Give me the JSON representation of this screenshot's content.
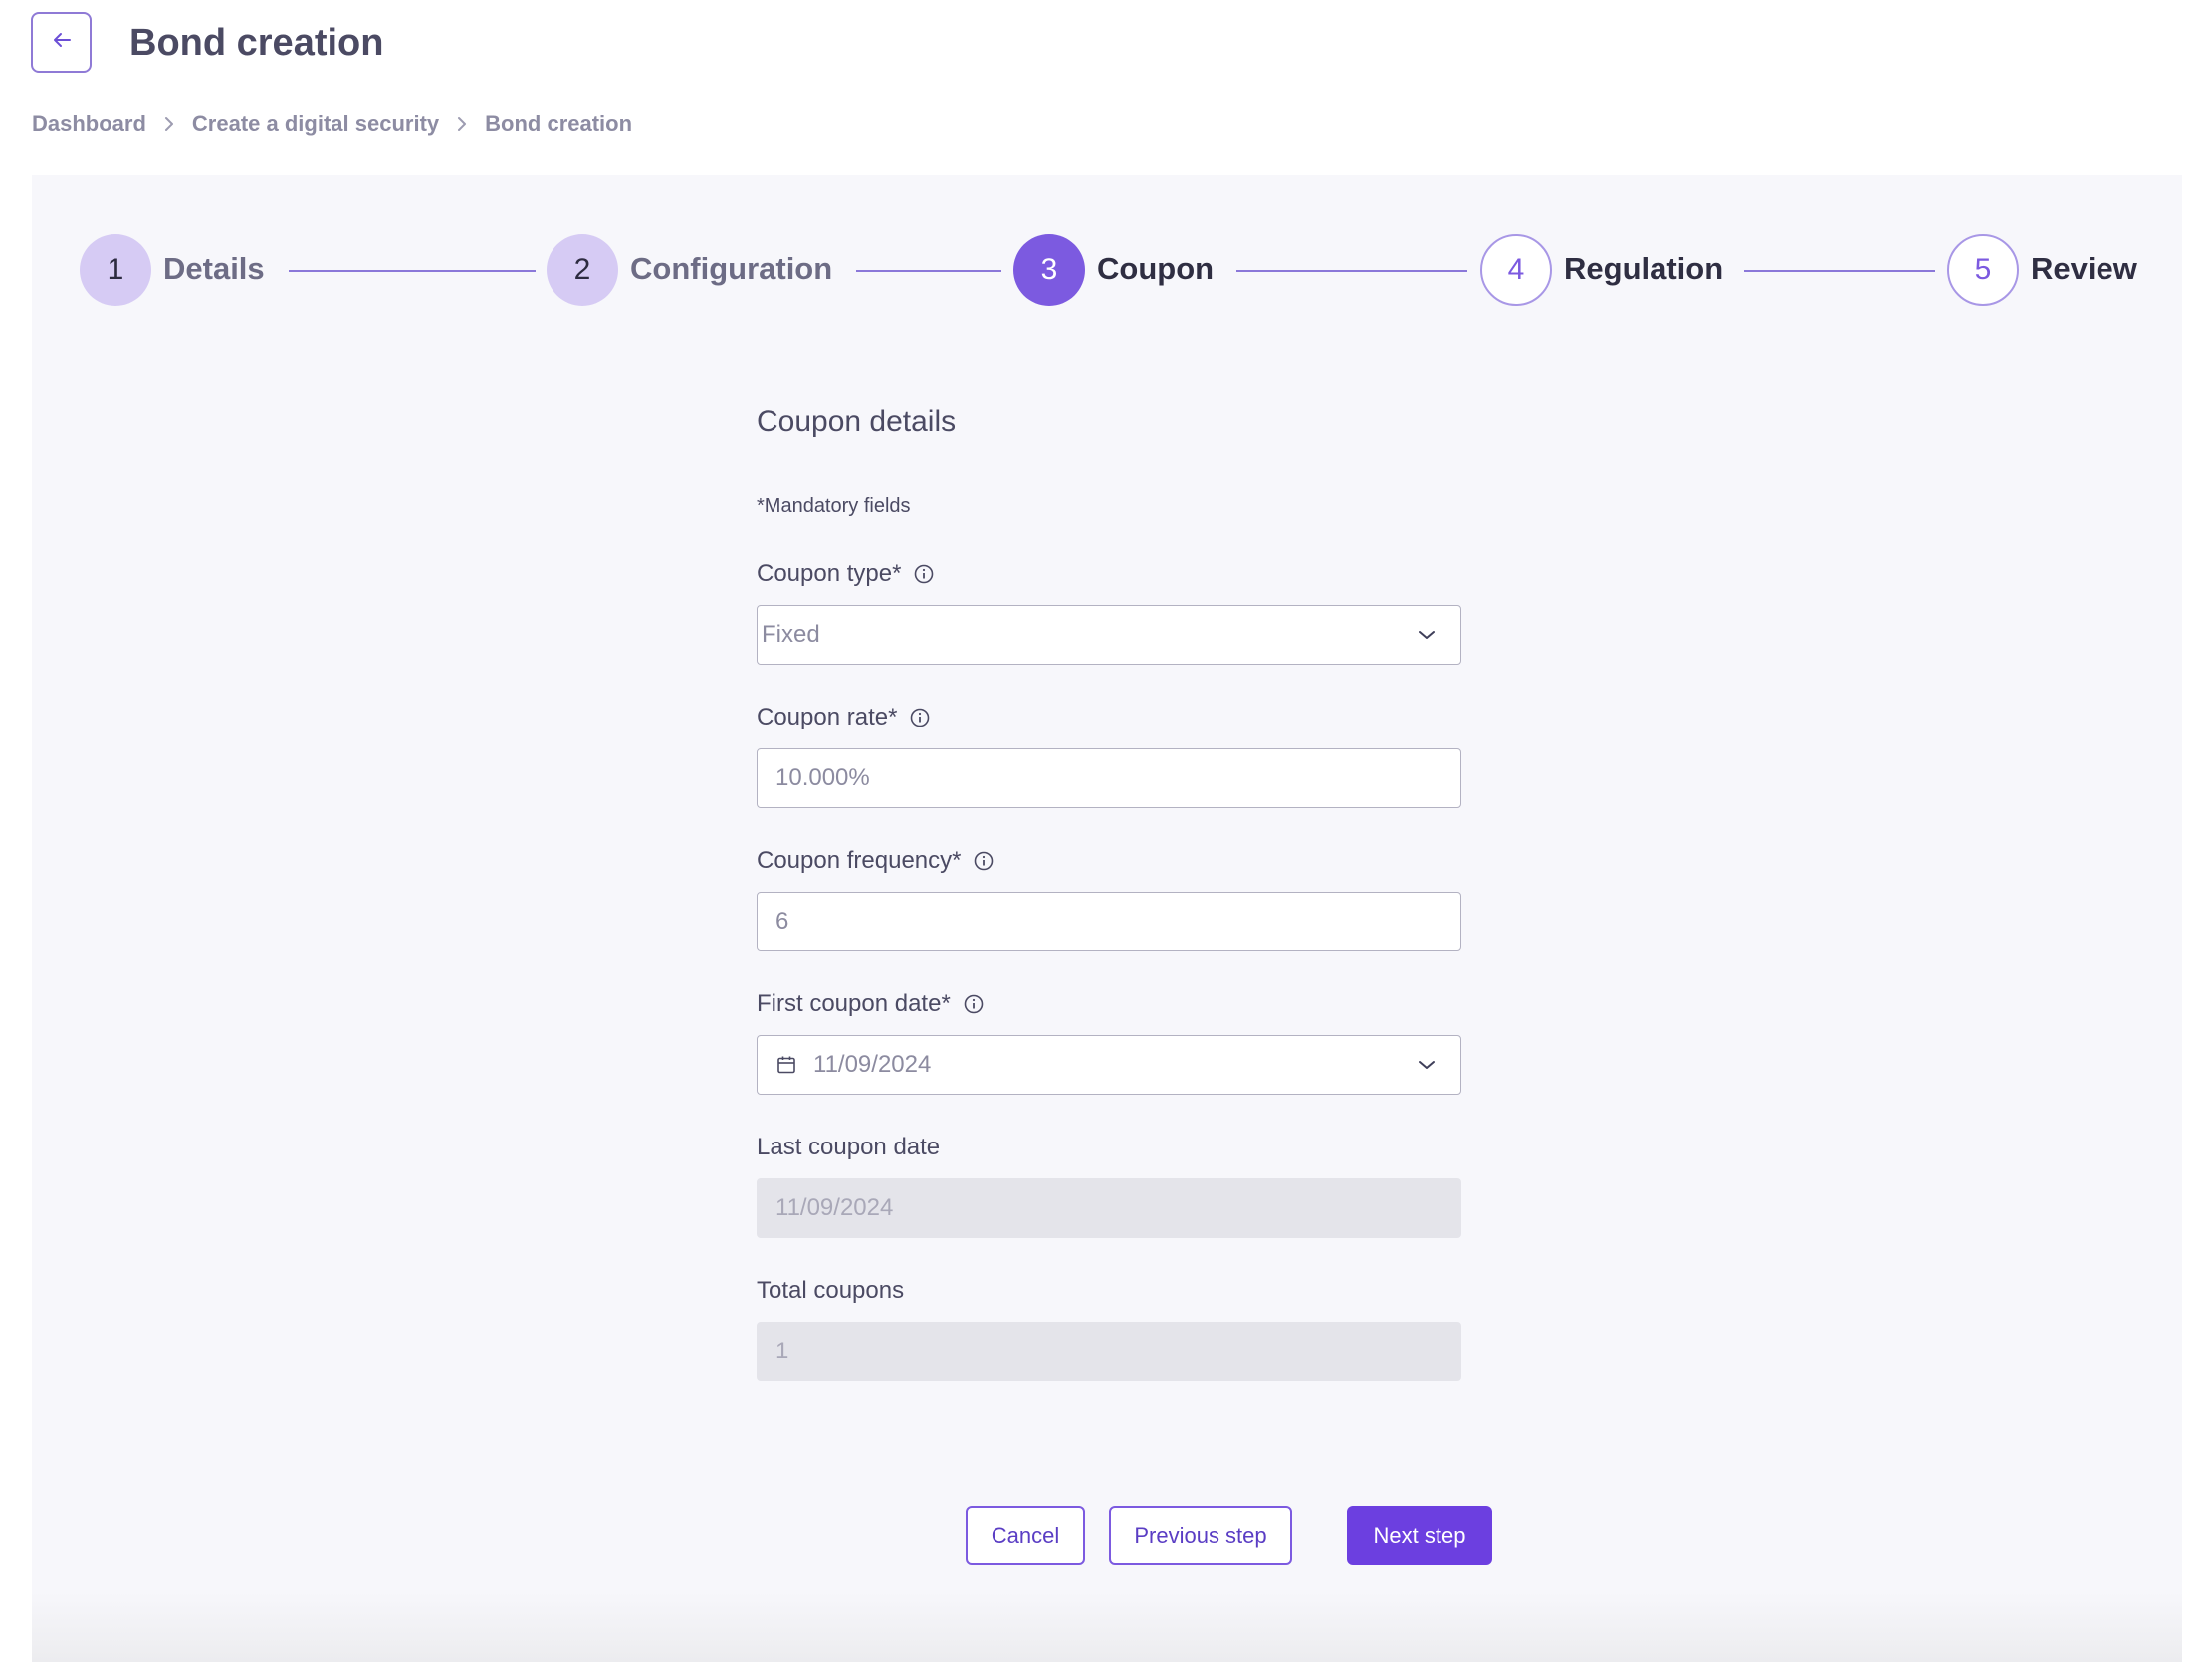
{
  "header": {
    "title": "Bond creation",
    "back_icon": "arrow-left-icon"
  },
  "breadcrumb": [
    "Dashboard",
    "Create a digital security",
    "Bond creation"
  ],
  "stepper": {
    "steps": [
      {
        "number": "1",
        "label": "Details",
        "state": "done"
      },
      {
        "number": "2",
        "label": "Configuration",
        "state": "done"
      },
      {
        "number": "3",
        "label": "Coupon",
        "state": "active"
      },
      {
        "number": "4",
        "label": "Regulation",
        "state": "todo"
      },
      {
        "number": "5",
        "label": "Review",
        "state": "todo"
      }
    ]
  },
  "form": {
    "section_title": "Coupon details",
    "mandatory_note": "*Mandatory fields",
    "coupon_type": {
      "label": "Coupon type*",
      "value": "Fixed"
    },
    "coupon_rate": {
      "label": "Coupon rate*",
      "value": "10.000%"
    },
    "coupon_frequency": {
      "label": "Coupon frequency*",
      "value": "6"
    },
    "first_coupon_date": {
      "label": "First coupon date*",
      "value": "11/09/2024"
    },
    "last_coupon_date": {
      "label": "Last coupon date",
      "value": "11/09/2024"
    },
    "total_coupons": {
      "label": "Total coupons",
      "value": "1"
    }
  },
  "actions": {
    "cancel": "Cancel",
    "previous": "Previous step",
    "next": "Next step"
  },
  "colors": {
    "accent": "#7c5ae0",
    "primary_button": "#6c3fe0",
    "step_done": "#d6cbf4",
    "panel_bg": "#f7f7fb",
    "disabled_field": "#e4e4ea"
  }
}
